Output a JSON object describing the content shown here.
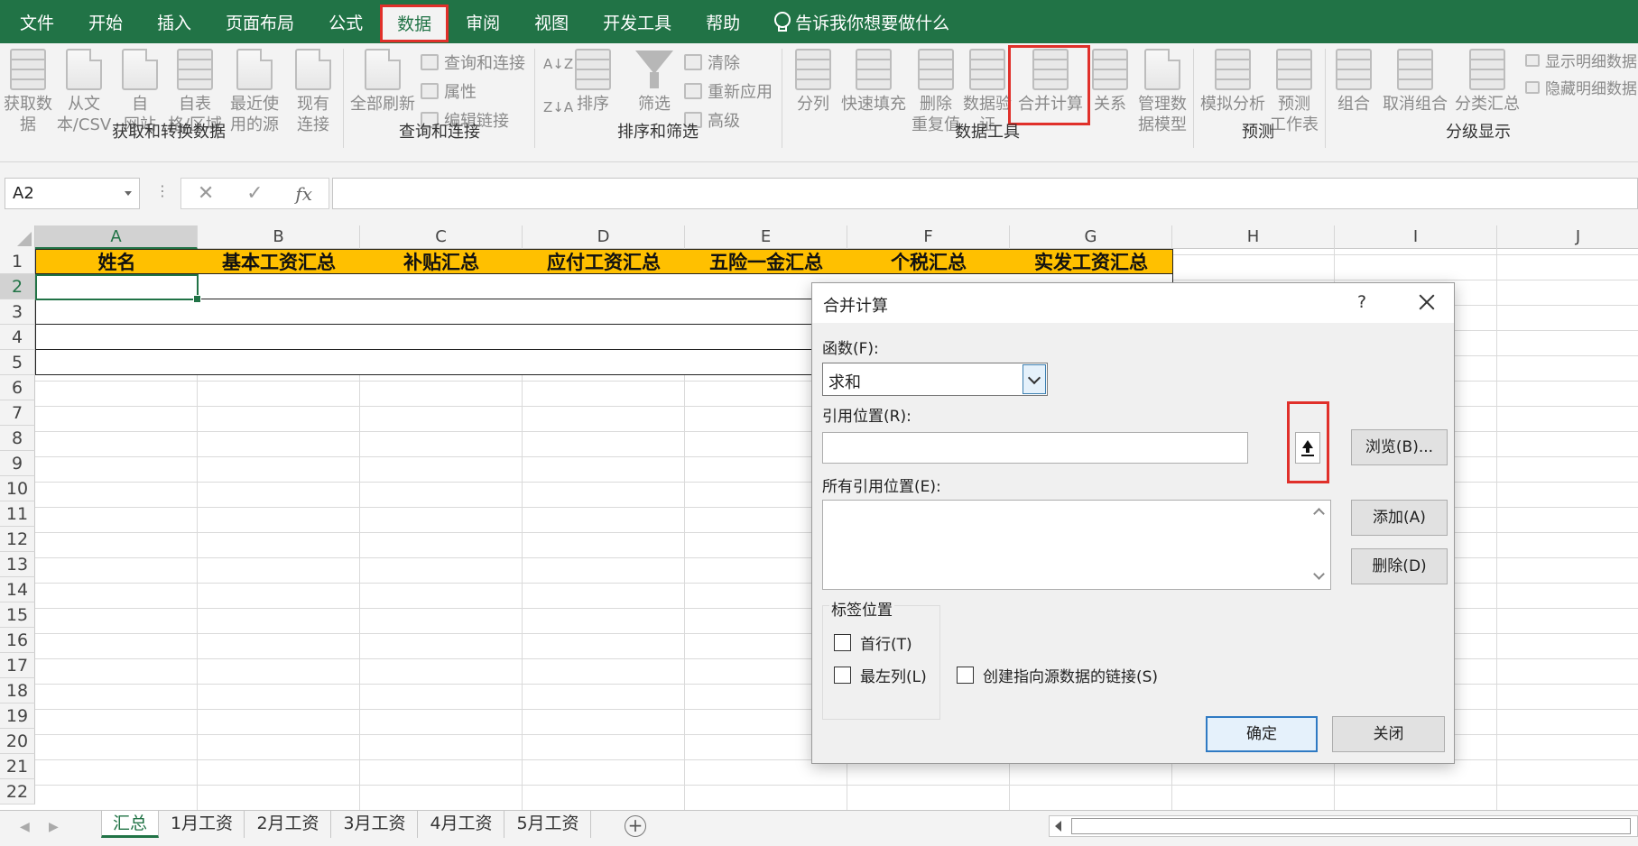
{
  "menu": {
    "items": [
      "文件",
      "开始",
      "插入",
      "页面布局",
      "公式",
      "数据",
      "审阅",
      "视图",
      "开发工具",
      "帮助"
    ],
    "active_index": 5,
    "tell_me": "告诉我你想要做什么"
  },
  "ribbon": {
    "get_data": "获取数\n据",
    "from_text": "从文\n本/CSV",
    "from_web": "自\n网站",
    "from_table": "自表\n格/区域",
    "recent_sources": "最近使\n用的源",
    "existing": "现有\n连接",
    "refresh_all": "全部刷新",
    "queries_connections": "查询和连接",
    "properties": "属性",
    "edit_links": "编辑链接",
    "sort": "排序",
    "filter": "筛选",
    "clear": "清除",
    "reapply": "重新应用",
    "advanced": "高级",
    "split_column": "分列",
    "flash_fill": "快速填充",
    "remove_duplicates": "删除\n重复值",
    "data_validation": "数据验\n证",
    "consolidate": "合并计算",
    "relationships": "关系",
    "manage_model": "管理数\n据模型",
    "what_if": "模拟分析",
    "forecast_sheet": "预测\n工作表",
    "group": "组合",
    "ungroup": "取消组合",
    "subtotal": "分类汇总",
    "show_detail": "显示明细数据",
    "hide_detail": "隐藏明细数据",
    "groups": {
      "get_transform": "获取和转换数据",
      "queries": "查询和连接",
      "sort_filter": "排序和筛选",
      "data_tools": "数据工具",
      "forecast": "预测",
      "outline": "分级显示"
    }
  },
  "formula_bar": {
    "name_box": "A2",
    "fx": "fx",
    "value": ""
  },
  "sheet": {
    "columns": [
      "A",
      "B",
      "C",
      "D",
      "E",
      "F",
      "G",
      "H",
      "I",
      "J"
    ],
    "rows": [
      "1",
      "2",
      "3",
      "4",
      "5",
      "6",
      "7",
      "8",
      "9",
      "10",
      "11",
      "12",
      "13",
      "14",
      "15",
      "16",
      "17",
      "18",
      "19",
      "20",
      "21",
      "22"
    ],
    "headers": [
      "姓名",
      "基本工资汇总",
      "补贴汇总",
      "应付工资汇总",
      "五险一金汇总",
      "个税汇总",
      "实发工资汇总"
    ]
  },
  "tabs": {
    "items": [
      "汇总",
      "1月工资",
      "2月工资",
      "3月工资",
      "4月工资",
      "5月工资"
    ],
    "active_index": 0
  },
  "dialog": {
    "title": "合并计算",
    "help": "?",
    "function_label": "函数(F):",
    "function_value": "求和",
    "reference_label": "引用位置(R):",
    "reference_value": "",
    "browse": "浏览(B)...",
    "all_references_label": "所有引用位置(E):",
    "add": "添加(A)",
    "delete": "删除(D)",
    "labels_group": "标签位置",
    "top_row": "首行(T)",
    "left_column": "最左列(L)",
    "create_links": "创建指向源数据的链接(S)",
    "ok": "确定",
    "close": "关闭"
  }
}
